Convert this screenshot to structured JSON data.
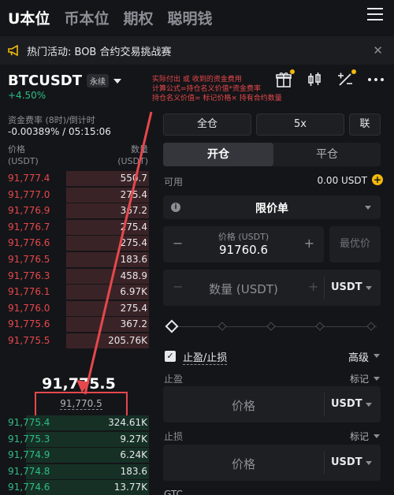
{
  "topnav": {
    "tabs": [
      "U本位",
      "币本位",
      "期权",
      "聪明钱"
    ]
  },
  "banner": {
    "text": "热门活动: BOB 合约交易挑战赛"
  },
  "symbol": {
    "name": "BTCUSDT",
    "badge": "永续",
    "change": "+4.50%"
  },
  "annotation": {
    "line1": "实际付出 或 收到的资金费用",
    "line2": "计算公式=持仓名义价值*资金费率",
    "line3": "持仓名义价值= 标记价格× 持有合约数量"
  },
  "funding": {
    "label": "资金费率 (8时)/倒计时",
    "value": "-0.00389% / 05:15:06"
  },
  "orderbook": {
    "price_header": "价格",
    "price_unit": "(USDT)",
    "qty_header": "数量",
    "qty_unit": "(USDT)",
    "asks": [
      {
        "price": "91,777.4",
        "qty": "550.7",
        "depth": 0.55
      },
      {
        "price": "91,777.0",
        "qty": "275.4",
        "depth": 0.55
      },
      {
        "price": "91,776.9",
        "qty": "367.2",
        "depth": 0.55
      },
      {
        "price": "91,776.7",
        "qty": "275.4",
        "depth": 0.55
      },
      {
        "price": "91,776.6",
        "qty": "275.4",
        "depth": 0.55
      },
      {
        "price": "91,776.5",
        "qty": "183.6",
        "depth": 0.55
      },
      {
        "price": "91,776.3",
        "qty": "458.9",
        "depth": 0.55
      },
      {
        "price": "91,776.1",
        "qty": "6.97K",
        "depth": 0.55
      },
      {
        "price": "91,776.0",
        "qty": "275.4",
        "depth": 0.55
      },
      {
        "price": "91,775.6",
        "qty": "367.2",
        "depth": 0.55
      },
      {
        "price": "91,775.5",
        "qty": "205.76K",
        "depth": 0.55
      }
    ],
    "last_price": "91,775.5",
    "mark_price": "91,770.5",
    "bids": [
      {
        "price": "91,775.4",
        "qty": "324.61K",
        "depth": 0.82
      },
      {
        "price": "91,775.3",
        "qty": "9.27K",
        "depth": 0.82
      },
      {
        "price": "91,774.9",
        "qty": "6.24K",
        "depth": 0.82
      },
      {
        "price": "91,774.8",
        "qty": "183.6",
        "depth": 0.82
      },
      {
        "price": "91,774.6",
        "qty": "13.77K",
        "depth": 0.82
      }
    ]
  },
  "margin": {
    "mode": "全仓",
    "leverage": "5x",
    "joint": "联"
  },
  "side": {
    "open": "开仓",
    "close": "平仓"
  },
  "available": {
    "label": "可用",
    "value": "0.00 USDT",
    "plus": "+"
  },
  "order_type": {
    "label": "限价单",
    "info": "i"
  },
  "price_input": {
    "caption": "价格 (USDT)",
    "value": "91760.6",
    "minus": "−",
    "plus": "+",
    "best": "最优价"
  },
  "qty_input": {
    "placeholder": "数量 (USDT)",
    "minus": "−",
    "plus": "+",
    "unit": "USDT"
  },
  "tpsl": {
    "check": "✓",
    "label": "止盈/止损",
    "advanced": "高级"
  },
  "take_profit": {
    "label": "止盈",
    "trigger": "标记",
    "placeholder": "价格",
    "unit": "USDT"
  },
  "stop_loss": {
    "label": "止损",
    "trigger": "标记",
    "placeholder": "价格",
    "unit": "USDT"
  },
  "tif": {
    "value": "GTC"
  },
  "colors": {
    "ask": "#e5484d",
    "bid": "#2ebd85",
    "accent": "#f0b90b",
    "annotation": "#e5484d"
  }
}
